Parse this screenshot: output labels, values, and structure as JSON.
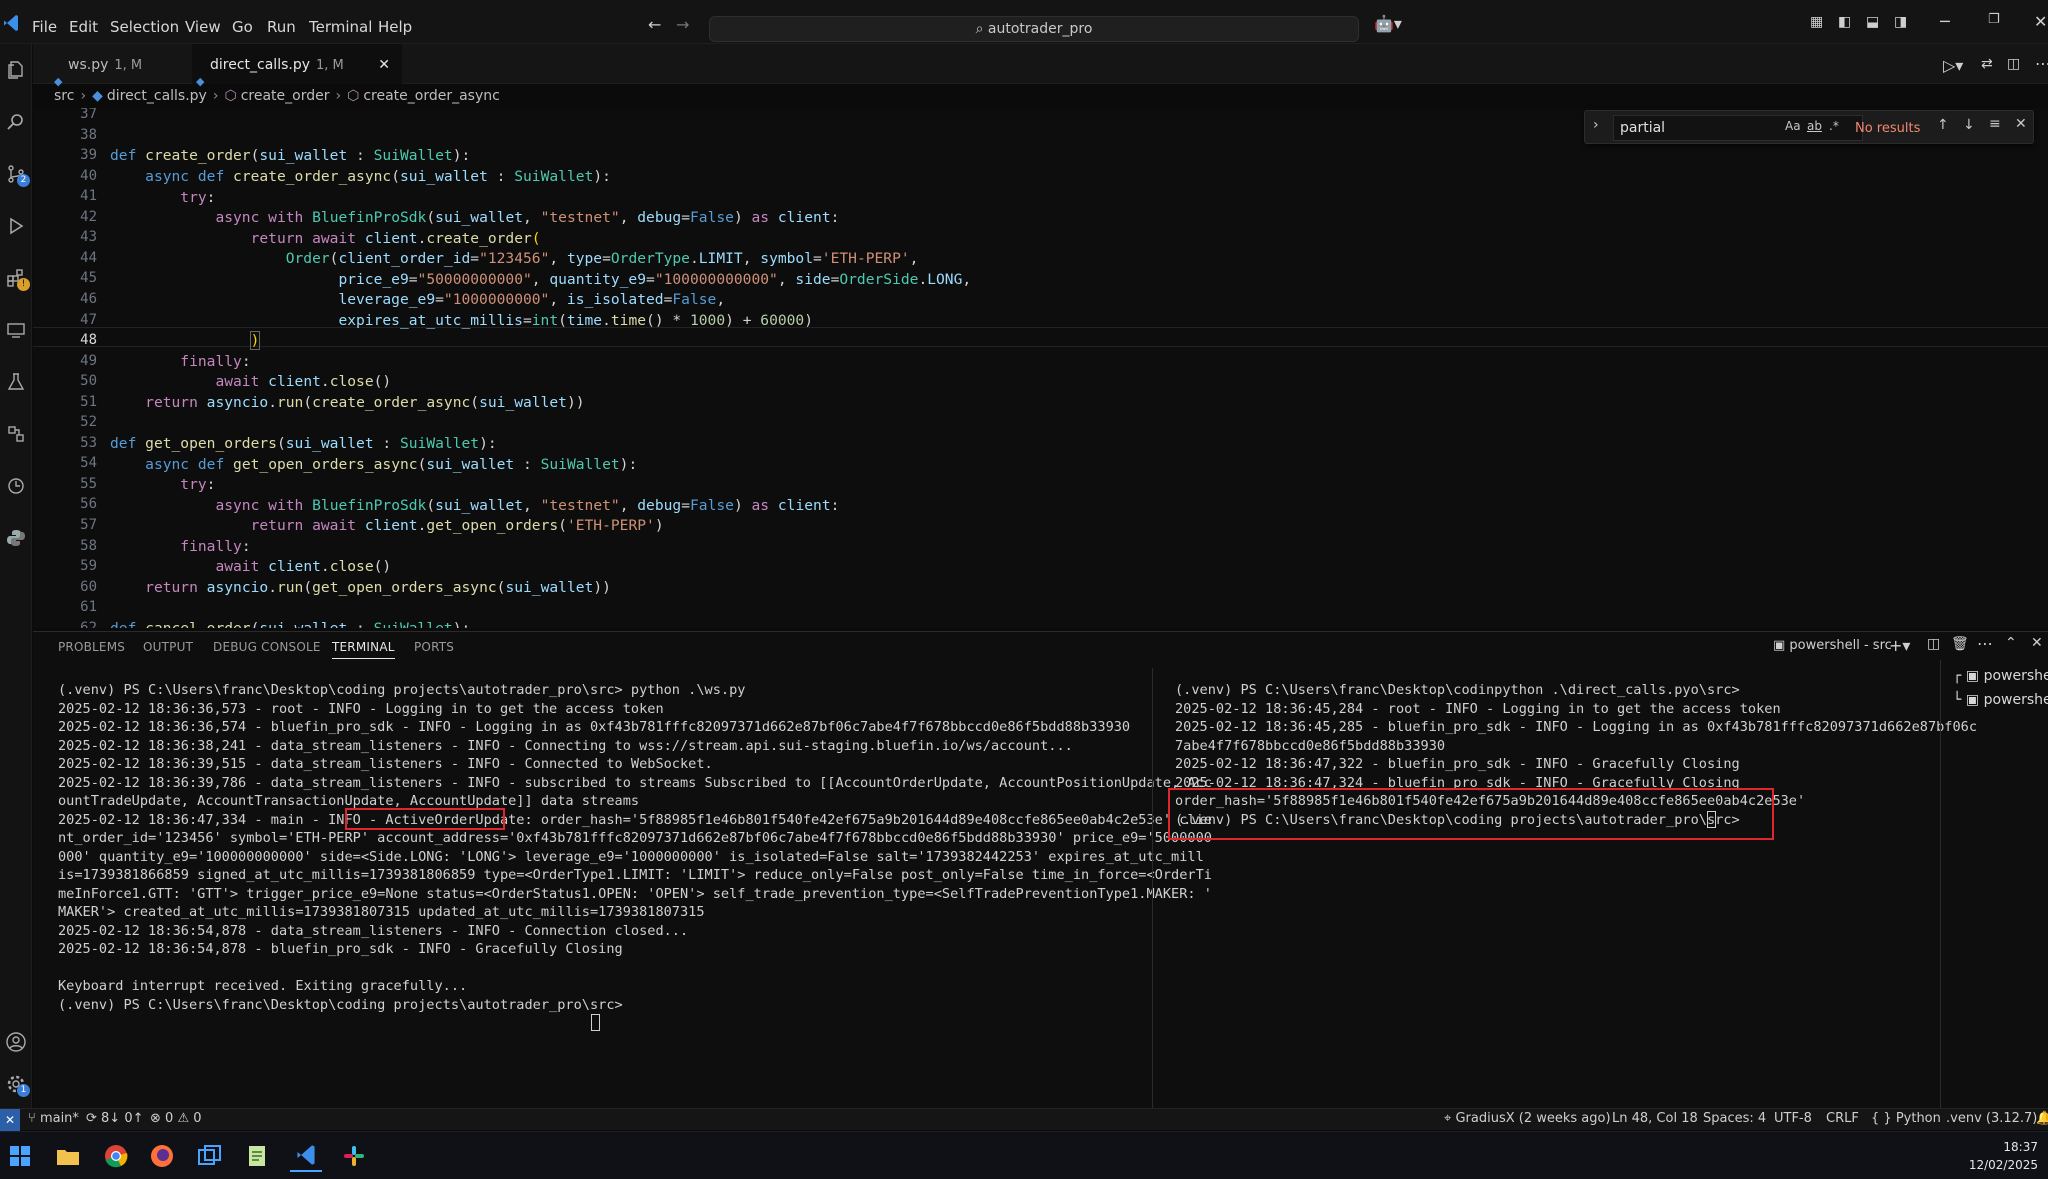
{
  "menu": [
    "File",
    "Edit",
    "Selection",
    "View",
    "Go",
    "Run",
    "Terminal",
    "Help"
  ],
  "search_box": "autotrader_pro",
  "tabs": [
    {
      "label": "ws.py",
      "mod": "1, M"
    },
    {
      "label": "direct_calls.py",
      "mod": "1, M"
    }
  ],
  "breadcrumb": [
    "src",
    "direct_calls.py",
    "create_order",
    "create_order_async"
  ],
  "find": {
    "value": "partial",
    "opt_case": "Aa",
    "opt_word": "ab",
    "opt_regex": ".*",
    "status": "No results"
  },
  "editor": {
    "line_numbers": [
      "37",
      "38",
      "39",
      "40",
      "41",
      "42",
      "43",
      "44",
      "45",
      "46",
      "47",
      "48",
      "49",
      "50",
      "51",
      "52",
      "53",
      "54",
      "55",
      "56",
      "57",
      "58",
      "59",
      "60",
      "61",
      "62"
    ]
  },
  "panel_tabs": [
    "PROBLEMS",
    "OUTPUT",
    "DEBUG CONSOLE",
    "TERMINAL",
    "PORTS"
  ],
  "terminal_selector": "powershell - src",
  "terminal_left": [
    "(.venv) PS C:\\Users\\franc\\Desktop\\coding projects\\autotrader_pro\\src> python .\\ws.py",
    "2025-02-12 18:36:36,573 - root - INFO - Logging in to get the access token",
    "2025-02-12 18:36:36,574 - bluefin_pro_sdk - INFO - Logging in as 0xf43b781fffc82097371d662e87bf06c7abe4f7f678bbccd0e86f5bdd88b33930",
    "2025-02-12 18:36:38,241 - data_stream_listeners - INFO - Connecting to wss://stream.api.sui-staging.bluefin.io/ws/account...",
    "2025-02-12 18:36:39,515 - data_stream_listeners - INFO - Connected to WebSocket.",
    "2025-02-12 18:36:39,786 - data_stream_listeners - INFO - subscribed to streams Subscribed to [[AccountOrderUpdate, AccountPositionUpdate, Acc",
    "ountTradeUpdate, AccountTransactionUpdate, AccountUpdate]] data streams",
    "2025-02-12 18:36:47,334 - main - INFO - ActiveOrderUpdate: order_hash='5f88985f1e46b801f540fe42ef675a9b201644d89e408ccfe865ee0ab4c2e53e' clie",
    "nt_order_id='123456' symbol='ETH-PERP' account_address='0xf43b781fffc82097371d662e87bf06c7abe4f7f678bbccd0e86f5bdd88b33930' price_e9='5000000",
    "000' quantity_e9='100000000000' side=<Side.LONG: 'LONG'> leverage_e9='1000000000' is_isolated=False salt='1739382442253' expires_at_utc_mill",
    "is=1739381866859 signed_at_utc_millis=1739381806859 type=<OrderType1.LIMIT: 'LIMIT'> reduce_only=False post_only=False time_in_force=<OrderTi",
    "meInForce1.GTT: 'GTT'> trigger_price_e9=None status=<OrderStatus1.OPEN: 'OPEN'> self_trade_prevention_type=<SelfTradePreventionType1.MAKER: '",
    "MAKER'> created_at_utc_millis=1739381807315 updated_at_utc_millis=1739381807315",
    "2025-02-12 18:36:54,878 - data_stream_listeners - INFO - Connection closed...",
    "2025-02-12 18:36:54,878 - bluefin_pro_sdk - INFO - Gracefully Closing",
    "",
    "Keyboard interrupt received. Exiting gracefully...",
    "(.venv) PS C:\\Users\\franc\\Desktop\\coding projects\\autotrader_pro\\src> "
  ],
  "terminal_right": [
    "(.venv) PS C:\\Users\\franc\\Desktop\\codinpython .\\direct_calls.pyo\\src>",
    "2025-02-12 18:36:45,284 - root - INFO - Logging in to get the access token",
    "2025-02-12 18:36:45,285 - bluefin_pro_sdk - INFO - Logging in as 0xf43b781fffc82097371d662e87bf06c",
    "7abe4f7f678bbccd0e86f5bdd88b33930",
    "2025-02-12 18:36:47,322 - bluefin_pro_sdk - INFO - Gracefully Closing",
    "2025-02-12 18:36:47,324 - bluefin_pro_sdk - INFO - Gracefully Closing",
    "order_hash='5f88985f1e46b801f540fe42ef675a9b201644d89e408ccfe865ee0ab4c2e53e'",
    "(.venv) PS C:\\Users\\franc\\Desktop\\coding projects\\autotrader_pro\\src> "
  ],
  "terminal_list": [
    "powershe",
    "powershe"
  ],
  "status": {
    "branch": "main*",
    "sync": "8↓ 0↑",
    "errors": "0",
    "warnings": "0",
    "blame": "GradiusX (2 weeks ago)",
    "position": "Ln 48, Col 18",
    "spaces": "Spaces: 4",
    "encoding": "UTF-8",
    "eol": "CRLF",
    "language": "Python",
    "interpreter": ".venv (3.12.7)"
  },
  "clock": {
    "time": "18:37",
    "date": "12/02/2025"
  },
  "colors": {
    "highlight": "#e0262d",
    "accent": "#3b7dd8"
  }
}
